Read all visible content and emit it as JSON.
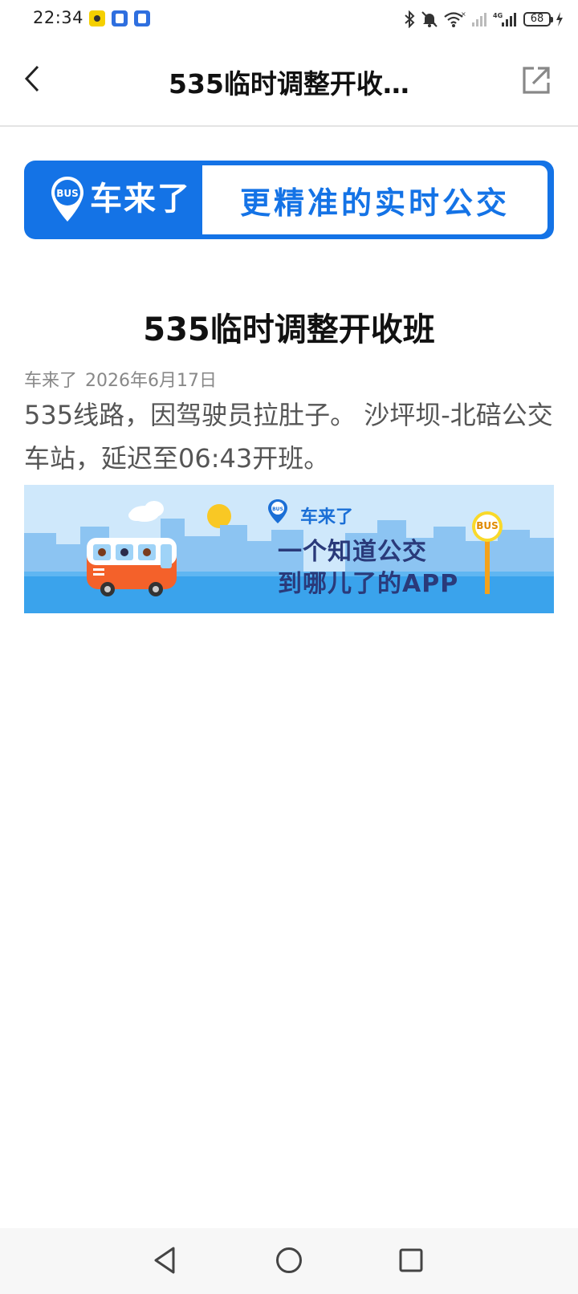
{
  "status_bar": {
    "time": "22:34",
    "battery_level": "68",
    "icons": [
      "bluetooth-icon",
      "mute-icon",
      "wifi-icon",
      "signal-icon",
      "4g-signal-icon",
      "battery-icon",
      "charging-icon"
    ]
  },
  "header": {
    "title": "535临时调整开收…",
    "back_icon": "chevron-left-icon",
    "share_icon": "share-external-icon"
  },
  "top_banner": {
    "logo_text": "BUS",
    "app_name": "车来了",
    "slogan": "更精准的实时公交",
    "brand_color": "#1473e6"
  },
  "article": {
    "title": "535临时调整开收班",
    "source": "车来了",
    "date": "2026年6月17日",
    "body": "535线路，因驾驶员拉肚子。 沙坪坝-北碚公交车站，延迟至06:43开班。"
  },
  "ad_banner": {
    "brand_name": "车来了",
    "line1": "一个知道公交",
    "line2": "到哪儿了的APP",
    "stop_sign_text": "BUS"
  },
  "nav_bar": {
    "items": [
      "back-triangle-icon",
      "home-circle-icon",
      "recents-square-icon"
    ]
  }
}
